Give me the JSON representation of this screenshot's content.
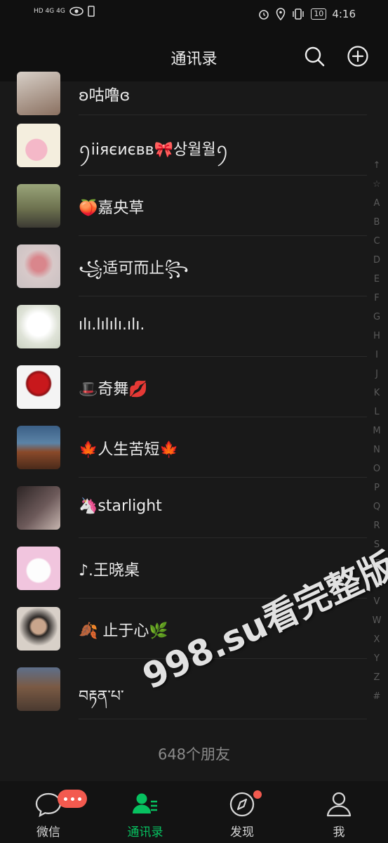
{
  "status_bar": {
    "time": "4:16",
    "battery": "10",
    "network_left": "HD 4G  4G"
  },
  "header": {
    "title": "通讯录"
  },
  "contacts": [
    {
      "name": "ʚ咕噜ɞ"
    },
    {
      "name": "ꪆiiяєиєвв🎀상월월ꪆ"
    },
    {
      "name": "🍑嘉央草"
    },
    {
      "name": "꧁适可而止꧂"
    },
    {
      "name": "ılı.lılılı.ılı."
    },
    {
      "name": "🎩奇舞💋"
    },
    {
      "name": "🍁人生苦短🍁"
    },
    {
      "name": "🦄starlight"
    },
    {
      "name": "♪.王晓桌"
    },
    {
      "name": "🍂 止于心🌿"
    },
    {
      "name": "བརྟན་པ་"
    }
  ],
  "index_letters": [
    "↑",
    "☆",
    "A",
    "B",
    "C",
    "D",
    "E",
    "F",
    "G",
    "H",
    "I",
    "J",
    "K",
    "L",
    "M",
    "N",
    "O",
    "P",
    "Q",
    "R",
    "S",
    "T",
    "U",
    "V",
    "W",
    "X",
    "Y",
    "Z",
    "#"
  ],
  "friend_count": "648个朋友",
  "watermark": "998.su看完整版",
  "tabs": [
    {
      "label": "微信",
      "icon": "chat-bubble-icon"
    },
    {
      "label": "通讯录",
      "icon": "contacts-icon"
    },
    {
      "label": "发现",
      "icon": "compass-icon"
    },
    {
      "label": "我",
      "icon": "person-icon"
    }
  ],
  "colors": {
    "accent": "#07c160",
    "badge": "#f35a4f",
    "background": "#191919"
  }
}
